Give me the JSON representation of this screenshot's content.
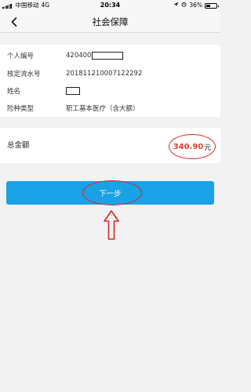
{
  "status_bar": {
    "carrier": "中国移动",
    "network": "4G",
    "time": "20:34",
    "battery": "36%"
  },
  "nav": {
    "title": "社会保障",
    "back_icon": "chevron-left-icon"
  },
  "info": {
    "rows": [
      {
        "label": "个人编号",
        "value": "420400"
      },
      {
        "label": "核定流水号",
        "value": "201811210007122292"
      },
      {
        "label": "姓名",
        "value": ""
      },
      {
        "label": "险种类型",
        "value": "职工基本医疗（含大额）"
      }
    ]
  },
  "total": {
    "label": "总金额",
    "amount": "340.90",
    "unit": "元"
  },
  "next_button": {
    "label": "下一步"
  },
  "colors": {
    "accent": "#1aa1e6",
    "amount_red": "#e23b2d",
    "annotation_red": "#d9262b"
  }
}
